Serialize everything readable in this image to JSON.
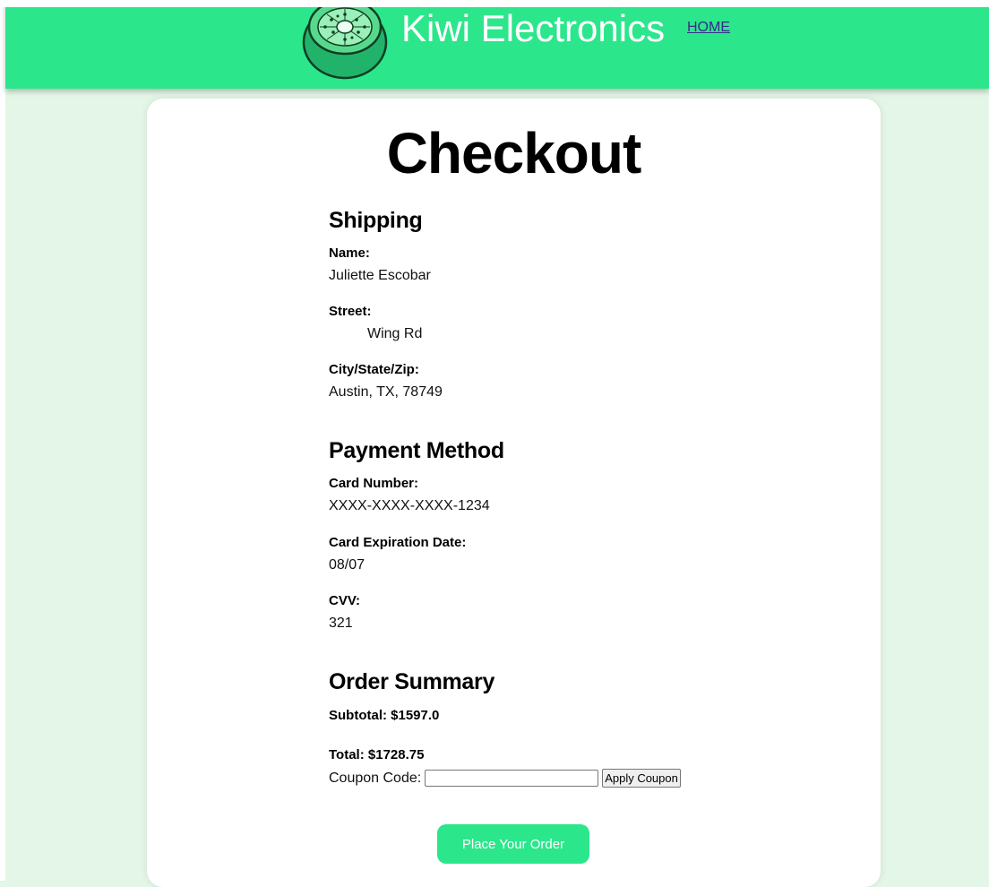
{
  "header": {
    "brand": "Kiwi Electronics",
    "home_link": "HOME",
    "logo_icon": "kiwi-fruit-icon",
    "background_color": "#2ce68c"
  },
  "page": {
    "title": "Checkout"
  },
  "shipping": {
    "heading": "Shipping",
    "name_label": "Name:",
    "name_value": "Juliette Escobar",
    "street_label": "Street:",
    "street_value": "Wing Rd",
    "city_label": "City/State/Zip:",
    "city_value": "Austin, TX, 78749"
  },
  "payment": {
    "heading": "Payment Method",
    "card_number_label": "Card Number:",
    "card_number_value": "XXXX-XXXX-XXXX-1234",
    "expiration_label": "Card Expiration Date:",
    "expiration_value": "08/07",
    "cvv_label": "CVV:",
    "cvv_value": "321"
  },
  "summary": {
    "heading": "Order Summary",
    "subtotal": "Subtotal: $1597.0",
    "total": "Total: $1728.75",
    "coupon_label": "Coupon Code:",
    "coupon_value": "",
    "apply_button": "Apply Coupon"
  },
  "actions": {
    "place_order": "Place Your Order"
  }
}
